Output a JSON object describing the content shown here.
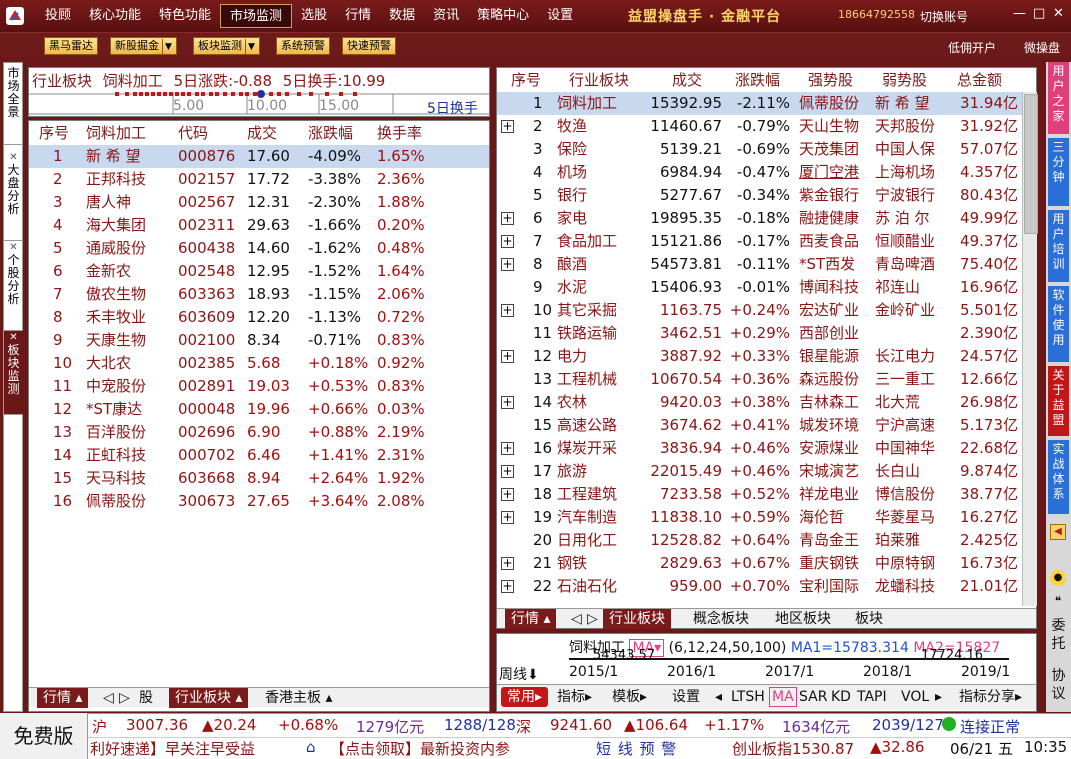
{
  "menubar": {
    "items": [
      "投顾",
      "核心功能",
      "特色功能",
      "市场监测",
      "选股",
      "行情",
      "数据",
      "资讯",
      "策略中心",
      "设置"
    ],
    "active": "市场监测",
    "brand": "益盟操盘手 · 金融平台",
    "phone": "18664792558",
    "switch_account": "切换账号"
  },
  "toolbar": {
    "buttons": [
      "黑马雷达",
      "新股掘金",
      "板块监测",
      "系统预警",
      "快速预警"
    ],
    "open_account": "低佣开户",
    "micro": "微操盘"
  },
  "left_tabs": [
    "市场全景",
    "大盘分析",
    "个股分析",
    "板块监测"
  ],
  "right_tabs": [
    "用户之家",
    "三分钟",
    "用户培训",
    "软件使用",
    "关于益盟",
    "实战体系"
  ],
  "right_icons": [
    "委托",
    "协议"
  ],
  "left_panel": {
    "info": {
      "sector_label": "行业板块",
      "sector": "饲料加工",
      "chg5_label": "5日涨跌:",
      "chg5": "-0.88",
      "turn5_label": "5日换手:",
      "turn5": "10.99"
    },
    "axis": {
      "ticks": [
        "5.00",
        "10.00",
        "15.00"
      ],
      "label": "5日换手"
    },
    "headers": [
      "序号",
      "饲料加工",
      "代码",
      "成交",
      "涨跌幅",
      "换手率"
    ],
    "rows": [
      [
        "1",
        "新 希 望",
        "000876",
        "17.60",
        "-4.09%",
        "1.65%"
      ],
      [
        "2",
        "正邦科技",
        "002157",
        "17.72",
        "-3.38%",
        "2.36%"
      ],
      [
        "3",
        "唐人神",
        "002567",
        "12.31",
        "-2.30%",
        "1.88%"
      ],
      [
        "4",
        "海大集团",
        "002311",
        "29.63",
        "-1.66%",
        "0.20%"
      ],
      [
        "5",
        "通威股份",
        "600438",
        "14.60",
        "-1.62%",
        "0.48%"
      ],
      [
        "6",
        "金新农",
        "002548",
        "12.95",
        "-1.52%",
        "1.64%"
      ],
      [
        "7",
        "傲农生物",
        "603363",
        "18.93",
        "-1.15%",
        "2.06%"
      ],
      [
        "8",
        "禾丰牧业",
        "603609",
        "12.20",
        "-1.13%",
        "0.72%"
      ],
      [
        "9",
        "天康生物",
        "002100",
        "8.34",
        "-0.71%",
        "0.83%"
      ],
      [
        "10",
        "大北农",
        "002385",
        "5.68",
        "+0.18%",
        "0.92%"
      ],
      [
        "11",
        "中宠股份",
        "002891",
        "19.03",
        "+0.53%",
        "0.83%"
      ],
      [
        "12",
        "*ST康达",
        "000048",
        "19.96",
        "+0.66%",
        "0.03%"
      ],
      [
        "13",
        "百洋股份",
        "002696",
        "6.90",
        "+0.88%",
        "2.19%"
      ],
      [
        "14",
        "正虹科技",
        "000702",
        "6.46",
        "+1.41%",
        "2.31%"
      ],
      [
        "15",
        "天马科技",
        "603668",
        "8.94",
        "+2.64%",
        "1.92%"
      ],
      [
        "16",
        "佩蒂股份",
        "300673",
        "27.65",
        "+3.64%",
        "2.08%"
      ]
    ],
    "bottom_tabs": [
      "行情",
      "股",
      "行业板块",
      "香港主板"
    ]
  },
  "right_panel": {
    "headers": [
      "序号",
      "行业板块",
      "成交",
      "涨跌幅",
      "强势股",
      "弱势股",
      "总金额"
    ],
    "rows": [
      [
        "1",
        "饲料加工",
        "15392.95",
        "-2.11%",
        "佩蒂股份",
        "新 希 望",
        "31.94亿"
      ],
      [
        "2",
        "牧渔",
        "11460.67",
        "-0.79%",
        "天山生物",
        "天邦股份",
        "31.92亿"
      ],
      [
        "3",
        "保险",
        "5139.21",
        "-0.69%",
        "天茂集团",
        "中国人保",
        "57.07亿"
      ],
      [
        "4",
        "机场",
        "6984.94",
        "-0.47%",
        "厦门空港",
        "上海机场",
        "4.357亿"
      ],
      [
        "5",
        "银行",
        "5277.67",
        "-0.34%",
        "紫金银行",
        "宁波银行",
        "80.43亿"
      ],
      [
        "6",
        "家电",
        "19895.35",
        "-0.18%",
        "融捷健康",
        "苏 泊 尔",
        "49.99亿"
      ],
      [
        "7",
        "食品加工",
        "15121.86",
        "-0.17%",
        "西麦食品",
        "恒顺醋业",
        "49.37亿"
      ],
      [
        "8",
        "酿酒",
        "54573.81",
        "-0.11%",
        "*ST西发",
        "青岛啤酒",
        "75.40亿"
      ],
      [
        "9",
        "水泥",
        "15406.93",
        "-0.01%",
        "博闻科技",
        "祁连山",
        "16.96亿"
      ],
      [
        "10",
        "其它采掘",
        "1163.75",
        "+0.24%",
        "宏达矿业",
        "金岭矿业",
        "5.501亿"
      ],
      [
        "11",
        "铁路运输",
        "3462.51",
        "+0.29%",
        "西部创业",
        "",
        "2.390亿"
      ],
      [
        "12",
        "电力",
        "3887.92",
        "+0.33%",
        "银星能源",
        "长江电力",
        "24.57亿"
      ],
      [
        "13",
        "工程机械",
        "10670.54",
        "+0.36%",
        "森远股份",
        "三一重工",
        "12.66亿"
      ],
      [
        "14",
        "农林",
        "9420.03",
        "+0.38%",
        "吉林森工",
        "北大荒",
        "26.98亿"
      ],
      [
        "15",
        "高速公路",
        "3674.62",
        "+0.41%",
        "城发环境",
        "宁沪高速",
        "5.173亿"
      ],
      [
        "16",
        "煤炭开采",
        "3836.94",
        "+0.46%",
        "安源煤业",
        "中国神华",
        "22.68亿"
      ],
      [
        "17",
        "旅游",
        "22015.49",
        "+0.46%",
        "宋城演艺",
        "长白山",
        "9.874亿"
      ],
      [
        "18",
        "工程建筑",
        "7233.58",
        "+0.52%",
        "祥龙电业",
        "博信股份",
        "38.77亿"
      ],
      [
        "19",
        "汽车制造",
        "11838.10",
        "+0.59%",
        "海伦哲",
        "华菱星马",
        "16.27亿"
      ],
      [
        "20",
        "日用化工",
        "12528.82",
        "+0.64%",
        "青岛金王",
        "珀莱雅",
        "2.425亿"
      ],
      [
        "21",
        "钢铁",
        "2829.63",
        "+0.67%",
        "重庆钢铁",
        "中原特钢",
        "16.73亿"
      ],
      [
        "22",
        "石油石化",
        "959.00",
        "+0.70%",
        "宝利国际",
        "龙蟠科技",
        "21.01亿"
      ]
    ],
    "expandable": [
      2,
      6,
      7,
      8,
      10,
      12,
      14,
      16,
      17,
      18,
      19,
      21,
      22
    ],
    "bottom_tabs": [
      "行情",
      "行业板块",
      "概念板块",
      "地区板块",
      "板块"
    ]
  },
  "kline": {
    "name": "饲料加工",
    "ma_btn": "MA",
    "params": "(6,12,24,50,100)",
    "ma1": "MA1=15783.314",
    "ma2": "MA2=15827",
    "price_hi": "54343.57",
    "price_lo": "17724.16",
    "period": "周线",
    "years": [
      "2015/1",
      "2016/1",
      "2017/1",
      "2018/1",
      "2019/1"
    ],
    "toolbar": [
      "常用",
      "指标",
      "模板",
      "设置",
      "LTSH",
      "MA",
      "SAR",
      "KD",
      "TAPI",
      "VOL",
      "指标分享"
    ]
  },
  "status": {
    "free": "免费版",
    "sh_label": "沪",
    "sh_val": "3007.36",
    "sh_chg": "▲20.24",
    "sh_pct": "+0.68%",
    "sh_amt": "1279亿元",
    "sh_cnt": "1288/128",
    "sz_label": "深",
    "sz_val": "9241.60",
    "sz_chg": "▲106.64",
    "sz_pct": "+1.17%",
    "sz_amt": "1634亿元",
    "sz_cnt": "2039/127",
    "conn": "连接正常",
    "ticker1": "利好速递】早关注早受益",
    "ticker2": "【点击领取】最新投资内参",
    "alert": "短 线 预 警",
    "cyb": "创业板指1530.87",
    "cyb_chg": "▲32.86",
    "date": "06/21 五",
    "time": "10:35"
  },
  "colors": {
    "frame": "#6a1717",
    "accent": "#7a1a1a",
    "select": "#c8d8ee"
  }
}
